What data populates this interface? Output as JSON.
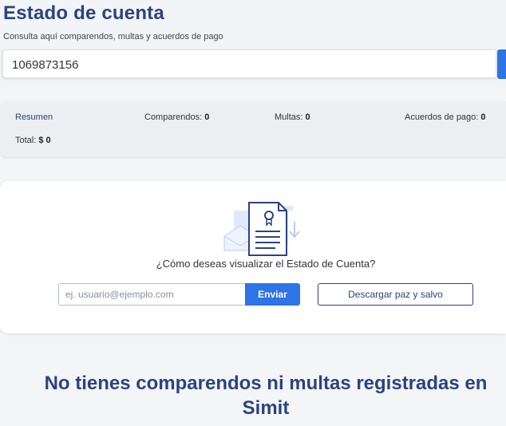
{
  "header": {
    "title": "Estado de cuenta",
    "subtitle": "Consulta aquí comparendos, multas y acuerdos de pago"
  },
  "search": {
    "value": "1069873156"
  },
  "summary": {
    "link_label": "Resumen",
    "comparendos_label": "Comparendos:",
    "comparendos_value": "0",
    "multas_label": "Multas:",
    "multas_value": "0",
    "acuerdos_label": "Acuerdos de pago:",
    "acuerdos_value": "0",
    "total_label": "Total:",
    "total_value": "$ 0"
  },
  "delivery": {
    "question": "¿Cómo deseas visualizar el Estado de Cuenta?",
    "email_placeholder": "ej. usuario@ejemplo.com",
    "send_label": "Enviar",
    "download_label": "Descargar paz y salvo"
  },
  "message": {
    "line1": "No tienes comparendos ni multas registradas en",
    "line2": "Simit"
  },
  "icons": {
    "illustration": "certificate-document-icon"
  },
  "colors": {
    "brand": "#2a4381",
    "accent": "#2d74e6"
  }
}
